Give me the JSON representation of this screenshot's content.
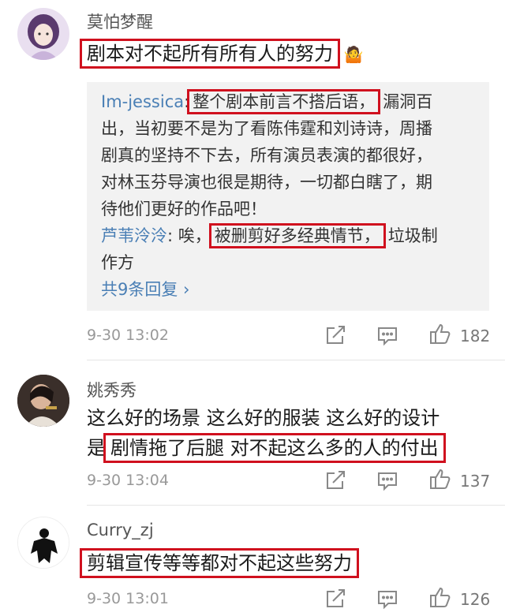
{
  "comments": [
    {
      "username": "莫怕梦醒",
      "text": "剧本对不起所有所有人的努力",
      "emoji": "🤷",
      "replies": [
        {
          "name": "Im-jessica",
          "sep": ":",
          "highlight": "整个剧本前言不搭后语，",
          "lines": [
            "漏洞百",
            "出，当初要不是为了看陈伟霆和刘诗诗，周播",
            "剧真的坚持不下去，所有演员表演的都很好，",
            "对林玉芬导演也很是期待，一切都白瞎了，期",
            "待他们更好的作品吧！"
          ]
        },
        {
          "name": "芦苇泠泠",
          "sep": ": 唉，",
          "highlight": "被删剪好多经典情节，",
          "lines": [
            "垃圾制",
            "作方"
          ]
        }
      ],
      "more_replies": "共9条回复 ›",
      "time": "9-30 13:02",
      "likes": "182"
    },
    {
      "username": "姚秀秀",
      "line1": "这么好的场景 这么好的服装 这么好的设计",
      "line2_prefix": "是",
      "line2_highlight": "剧情拖了后腿 对不起这么多的人的付出",
      "time": "9-30 13:04",
      "likes": "137"
    },
    {
      "username": "Curry_zj",
      "text": "剪辑宣传等等都对不起这些努力",
      "time": "9-30 13:01",
      "likes": "126"
    }
  ],
  "icons": {
    "share": "share-icon",
    "comment": "comment-icon",
    "like": "thumbs-up-icon"
  },
  "colors": {
    "highlight_border": "#d0101e",
    "link": "#4a7fb5",
    "reply_bg": "#f2f2f2"
  }
}
